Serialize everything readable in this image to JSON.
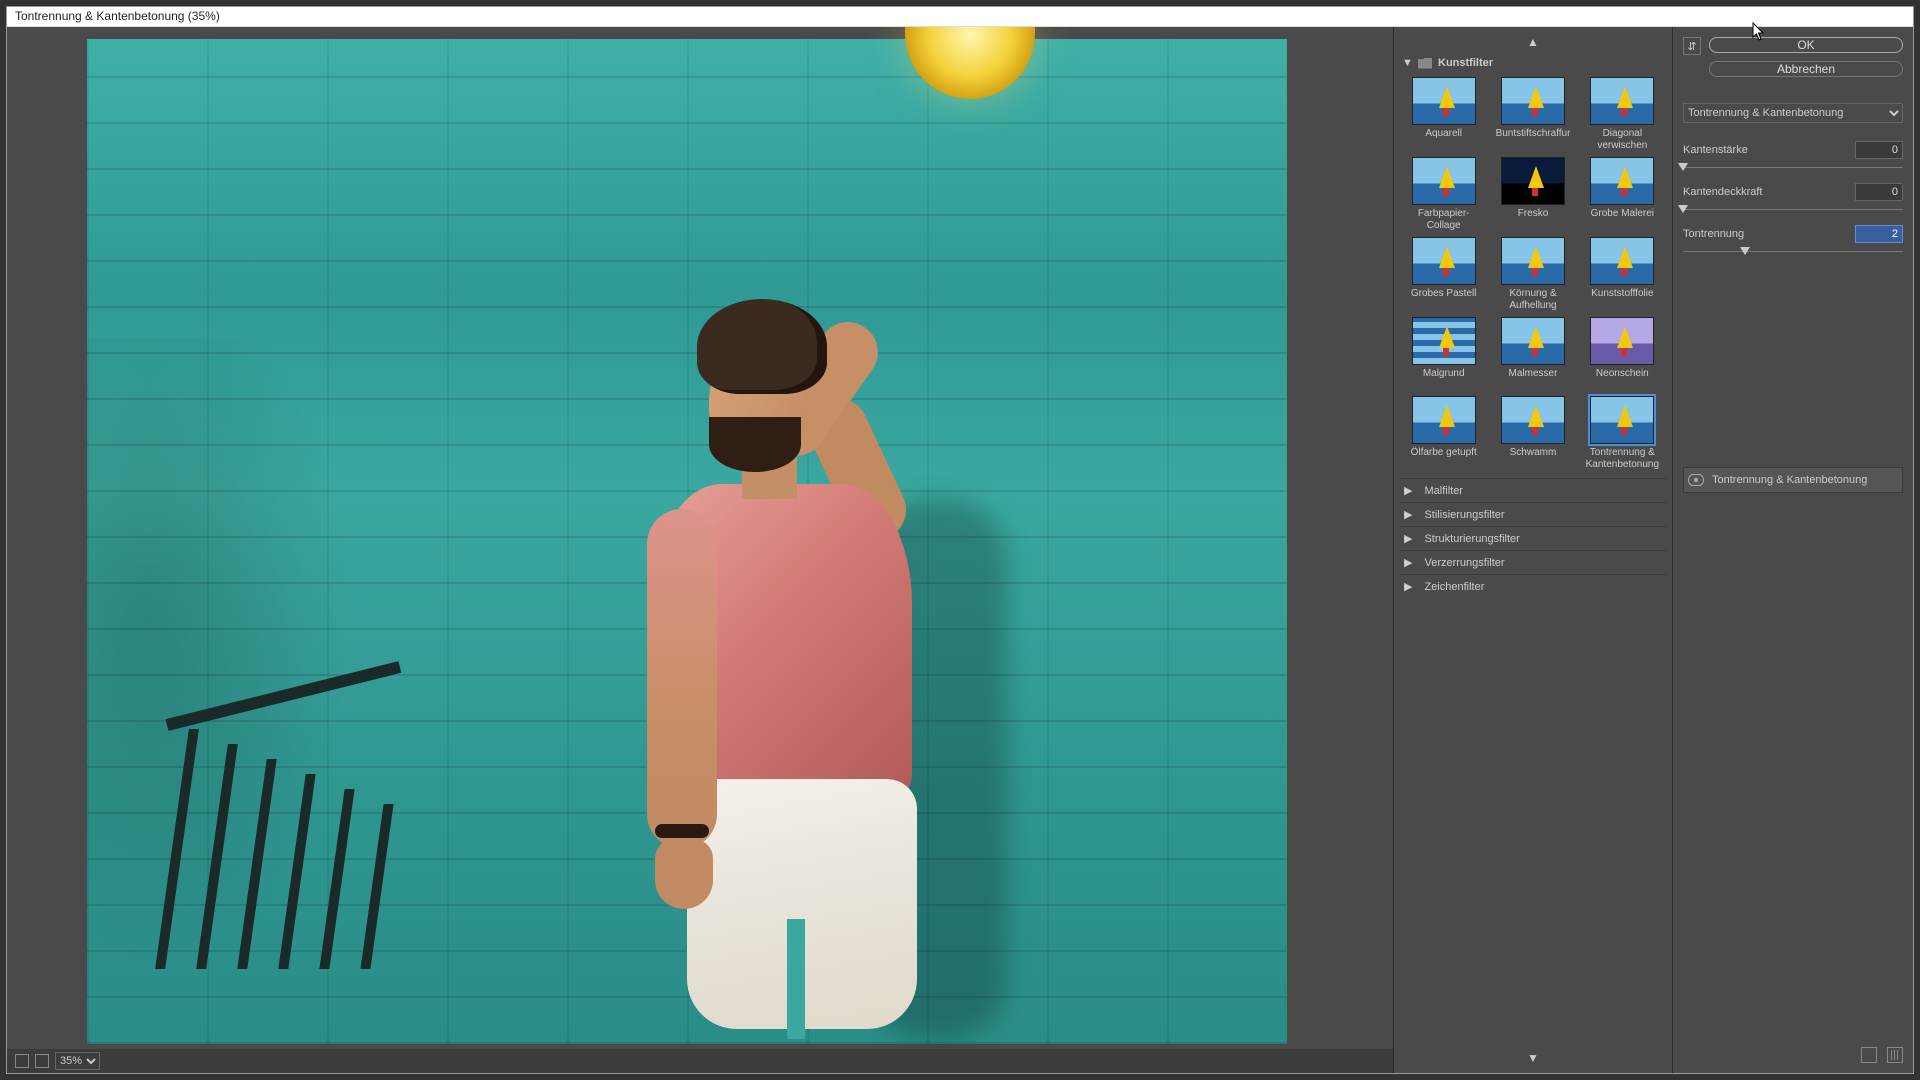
{
  "window": {
    "title": "Tontrennung & Kantenbetonung (35%)"
  },
  "zoom": {
    "value": "35%"
  },
  "gallery": {
    "open_category": "Kunstfilter",
    "thumbs": [
      {
        "label": "Aquarell"
      },
      {
        "label": "Buntstiftschraffur"
      },
      {
        "label": "Diagonal verwischen"
      },
      {
        "label": "Farbpapier-Collage"
      },
      {
        "label": "Fresko"
      },
      {
        "label": "Grobe Malerei"
      },
      {
        "label": "Grobes Pastell"
      },
      {
        "label": "Körnung & Aufhellung"
      },
      {
        "label": "Kunststofffolie"
      },
      {
        "label": "Malgrund"
      },
      {
        "label": "Malmesser"
      },
      {
        "label": "Neonschein"
      },
      {
        "label": "Ölfarbe getupft"
      },
      {
        "label": "Schwamm"
      },
      {
        "label": "Tontrennung & Kantenbetonung"
      }
    ],
    "selected_index": 14,
    "closed_categories": [
      "Malfilter",
      "Stilisierungsfilter",
      "Strukturierungsfilter",
      "Verzerrungsfilter",
      "Zeichenfilter"
    ]
  },
  "controls": {
    "ok": "OK",
    "cancel": "Abbrechen",
    "filter_select": "Tontrennung & Kantenbetonung",
    "params": [
      {
        "label": "Kantenstärke",
        "value": "0",
        "pos": 0
      },
      {
        "label": "Kantendeckkraft",
        "value": "0",
        "pos": 0
      },
      {
        "label": "Tontrennung",
        "value": "2",
        "pos": 28,
        "active": true
      }
    ]
  },
  "layers": {
    "row1": "Tontrennung & Kantenbetonung"
  }
}
